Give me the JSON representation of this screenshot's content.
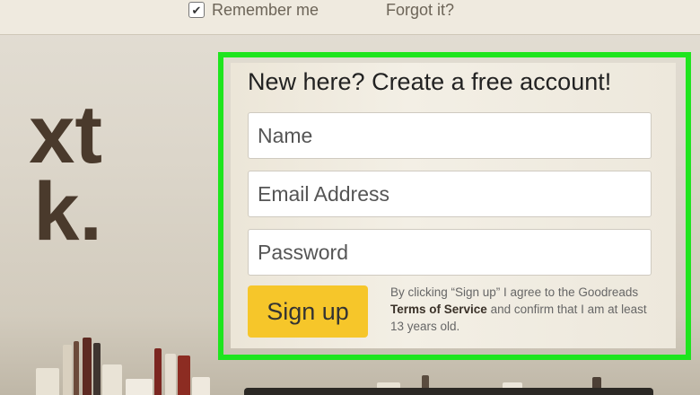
{
  "top": {
    "remember_label": "Remember me",
    "remember_checked": true,
    "forgot_label": "Forgot it?"
  },
  "hero": {
    "line1": "xt",
    "line2": "k."
  },
  "signup_form": {
    "title": "New here? Create a free account!",
    "name_placeholder": "Name",
    "email_placeholder": "Email Address",
    "password_placeholder": "Password",
    "button_label": "Sign up",
    "terms_before": "By clicking “Sign up” I agree to the Goodreads ",
    "terms_link": "Terms of Service",
    "terms_after": " and confirm that I am at least 13 years old."
  },
  "colors": {
    "highlight": "#1ee51e",
    "button": "#f6c62a"
  }
}
